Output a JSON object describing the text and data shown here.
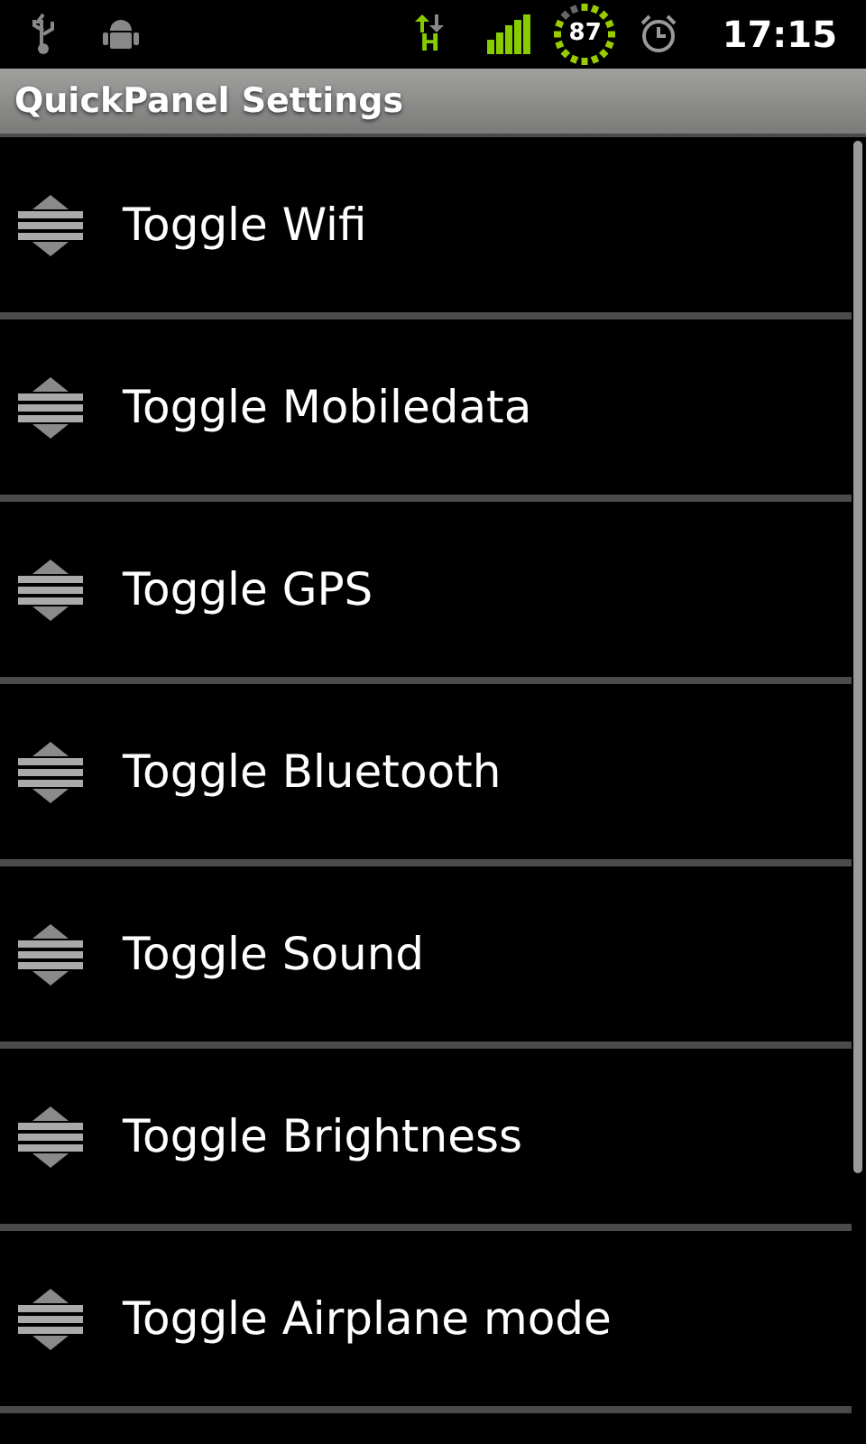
{
  "status_bar": {
    "network_type": "H",
    "battery": "87",
    "time": "17:15"
  },
  "title": "QuickPanel Settings",
  "items": [
    {
      "label": "Toggle Wifi"
    },
    {
      "label": "Toggle Mobiledata"
    },
    {
      "label": "Toggle GPS"
    },
    {
      "label": "Toggle Bluetooth"
    },
    {
      "label": "Toggle Sound"
    },
    {
      "label": "Toggle Brightness"
    },
    {
      "label": "Toggle Airplane mode"
    }
  ]
}
